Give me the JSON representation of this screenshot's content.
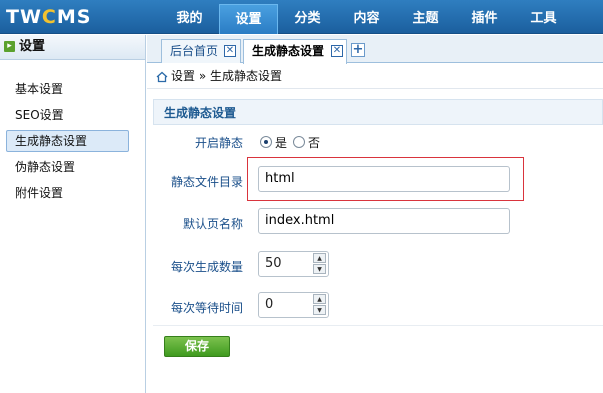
{
  "logo": {
    "part1": "TW",
    "part2": "C",
    "part3": "MS"
  },
  "topnav": {
    "items": [
      {
        "label": "我的"
      },
      {
        "label": "设置"
      },
      {
        "label": "分类"
      },
      {
        "label": "内容"
      },
      {
        "label": "主题"
      },
      {
        "label": "插件"
      },
      {
        "label": "工具"
      }
    ],
    "active_index": 1
  },
  "sidebar": {
    "header": "设置",
    "expand_glyph": "▸",
    "items": [
      {
        "label": "基本设置"
      },
      {
        "label": "SEO设置"
      },
      {
        "label": "生成静态设置"
      },
      {
        "label": "伪静态设置"
      },
      {
        "label": "附件设置"
      }
    ],
    "active_index": 2
  },
  "tabs": {
    "items": [
      {
        "label": "后台首页",
        "close": "✕"
      },
      {
        "label": "生成静态设置",
        "close": "✕"
      }
    ],
    "add_label": "+"
  },
  "breadcrumb": {
    "home": "设置",
    "separator": "»",
    "current": "生成静态设置"
  },
  "panel": {
    "title": "生成静态设置"
  },
  "form": {
    "enable_static": {
      "label": "开启静态",
      "options": [
        "是",
        "否"
      ],
      "selected": "是"
    },
    "static_dir": {
      "label": "静态文件目录",
      "value": "html"
    },
    "default_page": {
      "label": "默认页名称",
      "value": "index.html"
    },
    "per_batch": {
      "label": "每次生成数量",
      "value": "50"
    },
    "wait_time": {
      "label": "每次等待时间",
      "value": "0"
    }
  },
  "save_label": "保存",
  "colors": {
    "topbar": "#1b5f9e",
    "accent_logo": "#f2c230",
    "highlight": "#d9343d",
    "save_button": "#3f9a1f"
  }
}
